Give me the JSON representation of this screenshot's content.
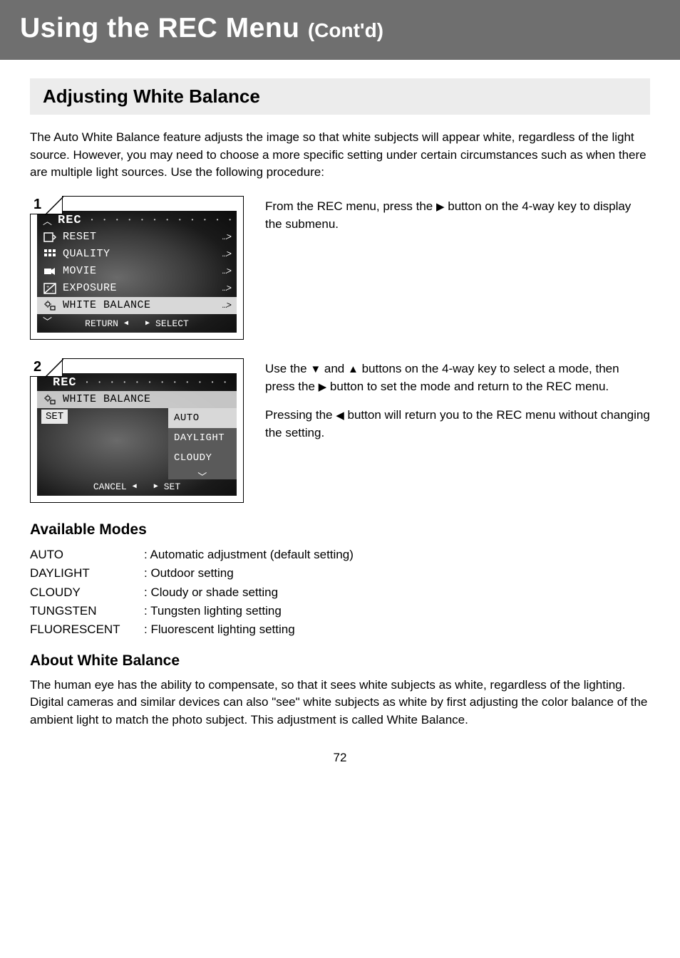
{
  "header": {
    "title_main": "Using the REC Menu ",
    "title_sub": "(Cont'd)"
  },
  "section_title": "Adjusting White Balance",
  "intro": "The Auto White Balance feature adjusts the image so that white subjects will appear white, regardless of the light source. However, you may need to choose a more specific setting under certain circumstances such as when there are multiple light sources. Use the following procedure:",
  "step1": {
    "num": "1",
    "screen": {
      "title": "REC",
      "rows": [
        {
          "icon": "reset",
          "label": "RESET",
          "arrow": "…>"
        },
        {
          "icon": "quality",
          "label": "QUALITY",
          "arrow": "…>"
        },
        {
          "icon": "movie",
          "label": "MOVIE",
          "arrow": "…>"
        },
        {
          "icon": "exposure",
          "label": "EXPOSURE",
          "arrow": "…>"
        },
        {
          "icon": "wb",
          "label": "WHITE BALANCE",
          "arrow": "…>",
          "highlight": true
        }
      ],
      "footer_left": "RETURN",
      "footer_right": "SELECT"
    },
    "text_parts": {
      "a": "From the REC menu, press the ",
      "b": " button on the 4-way key to display the submenu."
    }
  },
  "step2": {
    "num": "2",
    "screen": {
      "title": "REC",
      "wb_label": "WHITE BALANCE",
      "set_label": "SET",
      "options": [
        {
          "label": "AUTO",
          "selected": true
        },
        {
          "label": "DAYLIGHT"
        },
        {
          "label": "CLOUDY"
        }
      ],
      "footer_left": "CANCEL",
      "footer_right": "SET"
    },
    "text_parts": {
      "a": "Use the ",
      "b": " and ",
      "c": " buttons on the 4-way key to select a mode, then press the ",
      "d": " button to set the mode and return to the REC menu.",
      "note_a": "Pressing the ",
      "note_b": " button will return you to the REC menu without changing the setting."
    }
  },
  "available_modes": {
    "heading": "Available Modes",
    "rows": [
      {
        "label": "AUTO",
        "desc": ": Automatic adjustment (default setting)"
      },
      {
        "label": "DAYLIGHT",
        "desc": ": Outdoor setting"
      },
      {
        "label": "CLOUDY",
        "desc": ": Cloudy or shade setting"
      },
      {
        "label": "TUNGSTEN",
        "desc": ": Tungsten lighting setting"
      },
      {
        "label": "FLUORESCENT",
        "desc": ": Fluorescent lighting setting"
      }
    ]
  },
  "about": {
    "heading": "About White Balance",
    "text": "The human eye has the ability to compensate, so that it sees white subjects as white, regardless of the lighting. Digital cameras and similar devices can also \"see\" white subjects as white by first adjusting the color balance of the ambient light to match the photo subject. This adjustment is called White Balance."
  },
  "page_number": "72"
}
